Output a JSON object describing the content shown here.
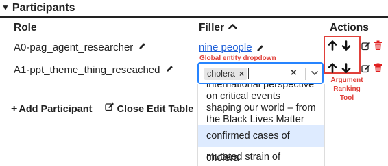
{
  "section": {
    "toggle_glyph": "▼",
    "title": "Participants"
  },
  "columns": {
    "role": "Role",
    "filler": "Filler",
    "actions": "Actions",
    "sort_icon": "chevron-up-icon"
  },
  "rows": [
    {
      "role": "A0-pag_agent_researcher",
      "filler_link": "nine people"
    },
    {
      "role": "A1-ppt_theme_thing_reseached"
    }
  ],
  "dropdown": {
    "chip_label": "cholera",
    "options": [
      "international perspective on critical events shaping our world – from the Black Lives Matter movement,",
      "confirmed cases of cholera",
      "mutated strain of pathogen"
    ],
    "highlighted_option": 1
  },
  "annotations": {
    "global_entity": "Global entity dropdown",
    "ranking_tool": "Argument Ranking Tool"
  },
  "footer": {
    "add_label": "Add Participant",
    "close_label": "Close Edit Table"
  },
  "colors": {
    "link": "#1e5fd8",
    "annotation": "#e0403a",
    "focus": "#2684ff",
    "delete": "#e02020",
    "highlight": "#deebff"
  }
}
